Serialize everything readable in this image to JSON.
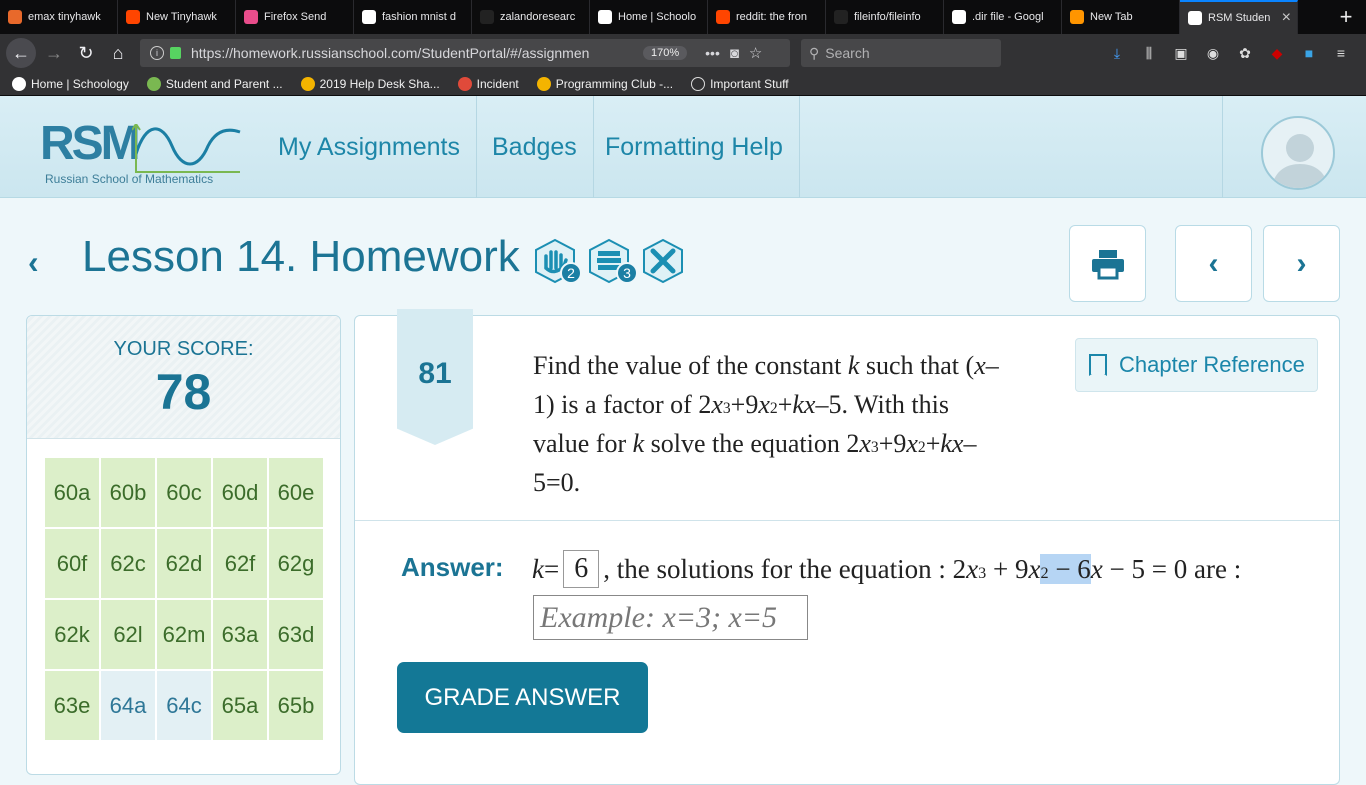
{
  "browser": {
    "tabs": [
      {
        "label": "emax tinyhawk",
        "icon": "bg-icon",
        "color": "#e8692b"
      },
      {
        "label": "New Tinyhawk",
        "icon": "reddit-icon",
        "color": "#ff4500"
      },
      {
        "label": "Firefox Send",
        "icon": "send-icon",
        "color": "#e94d8b"
      },
      {
        "label": "fashion mnist d",
        "icon": "google-icon",
        "color": "#ffffff"
      },
      {
        "label": "zalandoresearc",
        "icon": "github-icon",
        "color": "#222222"
      },
      {
        "label": "Home | Schoolo",
        "icon": "schoology-icon",
        "color": "#ffffff"
      },
      {
        "label": "reddit: the fron",
        "icon": "reddit-icon",
        "color": "#ff4500"
      },
      {
        "label": "fileinfo/fileinfo",
        "icon": "github-icon",
        "color": "#222222"
      },
      {
        "label": ".dir file - Googl",
        "icon": "google-icon",
        "color": "#ffffff"
      },
      {
        "label": "New Tab",
        "icon": "firefox-icon",
        "color": "#ff9500"
      },
      {
        "label": "RSM Studen",
        "icon": "rsm-icon",
        "color": "#ffffff"
      }
    ],
    "url": "https://homework.russianschool.com/StudentPortal/#/assignmen",
    "zoom": "170%",
    "search_placeholder": "Search",
    "bookmarks": [
      {
        "label": "Home | Schoology",
        "icon": "schoology-icon"
      },
      {
        "label": "Student and Parent ...",
        "icon": "parentvue-icon"
      },
      {
        "label": "2019 Help Desk Sha...",
        "icon": "drive-icon"
      },
      {
        "label": "Incident",
        "icon": "incident-icon"
      },
      {
        "label": "Programming Club -...",
        "icon": "drive-icon"
      },
      {
        "label": "Important Stuff",
        "icon": "folder-icon"
      }
    ]
  },
  "header": {
    "logo_text": "RSM",
    "logo_subtitle": "Russian School of Mathematics",
    "nav": [
      "My Assignments",
      "Badges",
      "Formatting Help"
    ]
  },
  "lesson": {
    "title": "Lesson 14. Homework",
    "badges": [
      {
        "icon": "hand-icon",
        "count": "2"
      },
      {
        "icon": "books-icon",
        "count": "3"
      },
      {
        "icon": "ruler-pencil-icon",
        "count": ""
      }
    ]
  },
  "score": {
    "label": "YOUR SCORE:",
    "value": "78"
  },
  "problems": [
    {
      "id": "60a",
      "state": "ok"
    },
    {
      "id": "60b",
      "state": "ok"
    },
    {
      "id": "60c",
      "state": "ok"
    },
    {
      "id": "60d",
      "state": "ok"
    },
    {
      "id": "60e",
      "state": "ok"
    },
    {
      "id": "60f",
      "state": "ok"
    },
    {
      "id": "62c",
      "state": "ok"
    },
    {
      "id": "62d",
      "state": "ok"
    },
    {
      "id": "62f",
      "state": "ok"
    },
    {
      "id": "62g",
      "state": "ok"
    },
    {
      "id": "62k",
      "state": "ok"
    },
    {
      "id": "62l",
      "state": "ok"
    },
    {
      "id": "62m",
      "state": "ok"
    },
    {
      "id": "63a",
      "state": "ok"
    },
    {
      "id": "63d",
      "state": "ok"
    },
    {
      "id": "63e",
      "state": "ok"
    },
    {
      "id": "64a",
      "state": "cur"
    },
    {
      "id": "64c",
      "state": "cur"
    },
    {
      "id": "65a",
      "state": "ok"
    },
    {
      "id": "65b",
      "state": "ok"
    }
  ],
  "problem": {
    "number": "81",
    "chapter_ref": "Chapter Reference",
    "answer_label": "Answer:",
    "k_value": "6",
    "solutions_text": ", the solutions for the equation :",
    "solution_placeholder": "Example: x=3; x=5",
    "grade_button": "GRADE ANSWER"
  }
}
